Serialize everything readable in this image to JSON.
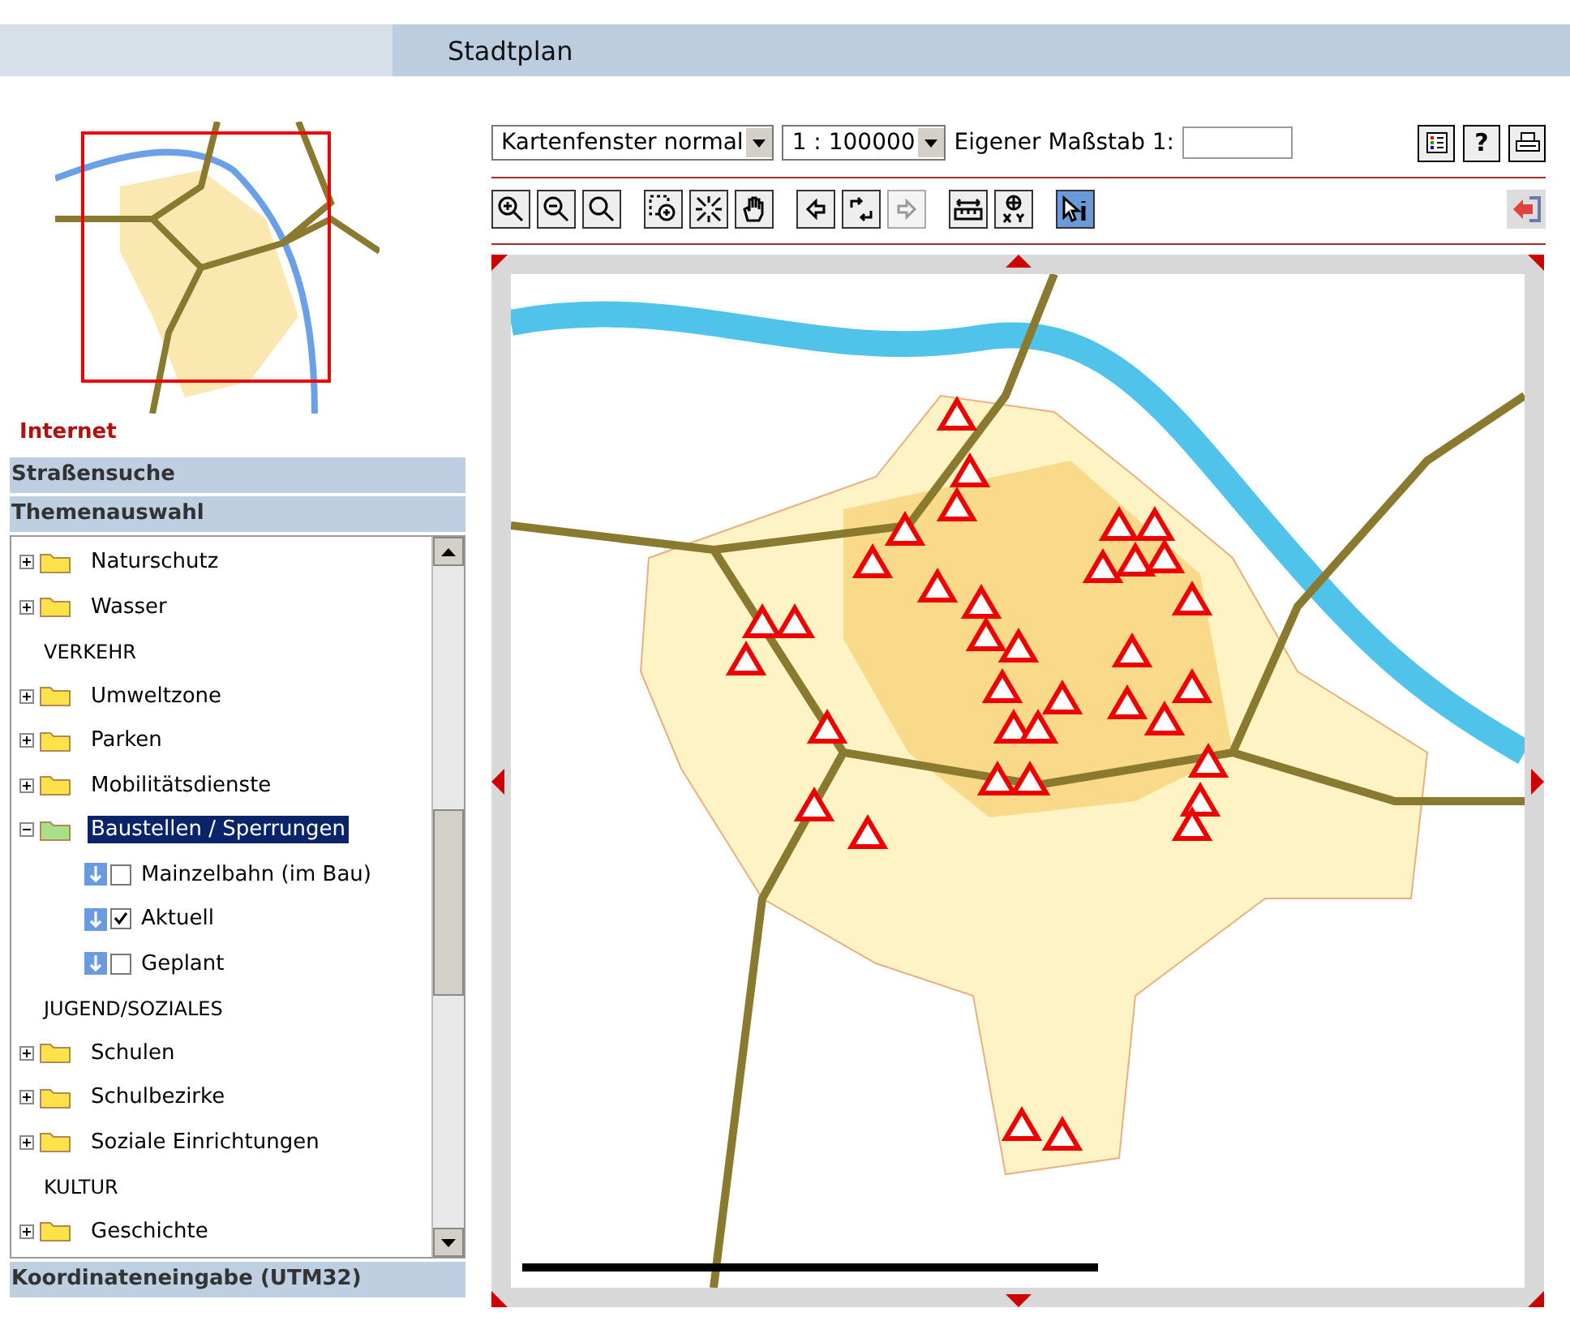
{
  "header": {
    "title": "Stadtplan"
  },
  "sidebar": {
    "context": "Internet",
    "sections": [
      {
        "label": "Straßensuche"
      },
      {
        "label": "Themenauswahl"
      }
    ],
    "tree": [
      {
        "kind": "folder",
        "label": "Naturschutz",
        "expanded": false,
        "selected": false
      },
      {
        "kind": "folder",
        "label": "Wasser",
        "expanded": false,
        "selected": false
      },
      {
        "kind": "category",
        "label": "VERKEHR"
      },
      {
        "kind": "folder",
        "label": "Umweltzone",
        "expanded": false,
        "selected": false
      },
      {
        "kind": "folder",
        "label": "Parken",
        "expanded": false,
        "selected": false
      },
      {
        "kind": "folder",
        "label": "Mobilitätsdienste",
        "expanded": false,
        "selected": false
      },
      {
        "kind": "folder",
        "label": "Baustellen / Sperrungen",
        "expanded": true,
        "selected": true,
        "children": [
          {
            "label": "Mainzelbahn (im Bau)",
            "checked": false
          },
          {
            "label": "Aktuell",
            "checked": true
          },
          {
            "label": "Geplant",
            "checked": false
          }
        ]
      },
      {
        "kind": "category",
        "label": "JUGEND/SOZIALES"
      },
      {
        "kind": "folder",
        "label": "Schulen",
        "expanded": false,
        "selected": false
      },
      {
        "kind": "folder",
        "label": "Schulbezirke",
        "expanded": false,
        "selected": false
      },
      {
        "kind": "folder",
        "label": "Soziale Einrichtungen",
        "expanded": false,
        "selected": false
      },
      {
        "kind": "category",
        "label": "KULTUR"
      },
      {
        "kind": "folder",
        "label": "Geschichte",
        "expanded": false,
        "selected": false
      }
    ],
    "footer_section": {
      "label": "Koordinateneingabe (UTM32)"
    }
  },
  "controls": {
    "window_select": {
      "value": "Kartenfenster normal"
    },
    "scale_select": {
      "value": "1 : 100000"
    },
    "custom_scale": {
      "label": "Eigener Maßstab 1:"
    },
    "actions": [
      {
        "kind": "legend"
      },
      {
        "kind": "help",
        "label": "?"
      },
      {
        "kind": "print"
      }
    ]
  },
  "tool_groups": [
    {
      "tools": [
        {
          "kind": "zoom-in",
          "selected": false,
          "disabled": false
        },
        {
          "kind": "zoom-out",
          "selected": false,
          "disabled": false
        },
        {
          "kind": "zoom",
          "selected": false,
          "disabled": false
        }
      ]
    },
    {
      "tools": [
        {
          "kind": "zoom-box",
          "selected": false,
          "disabled": false
        },
        {
          "kind": "zoom-full",
          "selected": false,
          "disabled": false
        },
        {
          "kind": "pan",
          "selected": false,
          "disabled": false
        }
      ]
    },
    {
      "tools": [
        {
          "kind": "back",
          "selected": false,
          "disabled": false
        },
        {
          "kind": "refresh",
          "selected": false,
          "disabled": false
        },
        {
          "kind": "forward",
          "selected": false,
          "disabled": true
        }
      ]
    },
    {
      "tools": [
        {
          "kind": "measure",
          "selected": false,
          "disabled": false
        },
        {
          "kind": "coordinates",
          "selected": false,
          "disabled": false
        }
      ]
    },
    {
      "tools": [
        {
          "kind": "info",
          "selected": true,
          "disabled": false
        }
      ]
    }
  ]
}
